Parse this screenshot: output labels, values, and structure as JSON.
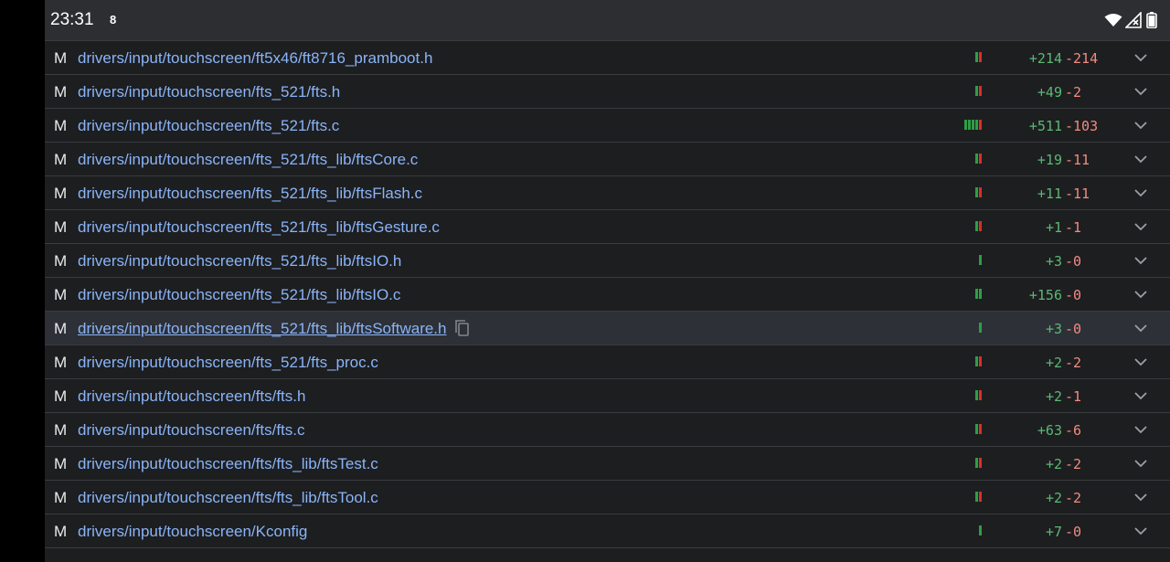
{
  "status_bar": {
    "time": "23:31",
    "notification_glyph": "8",
    "icons": [
      "wifi-icon",
      "signal-icon",
      "battery-icon"
    ]
  },
  "colors": {
    "path": "#8ab4f8",
    "added": "#5bb974",
    "deleted": "#f28b82",
    "bar_add": "#2e9e45",
    "bar_del": "#d93025"
  },
  "files": [
    {
      "status": "M",
      "path": "drivers/input/touchscreen/ft5x46/ft8716_pramboot.h",
      "added": "+214",
      "deleted": "-214",
      "bar": {
        "add": 1,
        "del": 1
      }
    },
    {
      "status": "M",
      "path": "drivers/input/touchscreen/fts_521/fts.h",
      "added": "+49",
      "deleted": "-2",
      "bar": {
        "add": 1,
        "del": 1
      }
    },
    {
      "status": "M",
      "path": "drivers/input/touchscreen/fts_521/fts.c",
      "added": "+511",
      "deleted": "-103",
      "bar": {
        "add": 4,
        "del": 1
      }
    },
    {
      "status": "M",
      "path": "drivers/input/touchscreen/fts_521/fts_lib/ftsCore.c",
      "added": "+19",
      "deleted": "-11",
      "bar": {
        "add": 1,
        "del": 1
      }
    },
    {
      "status": "M",
      "path": "drivers/input/touchscreen/fts_521/fts_lib/ftsFlash.c",
      "added": "+11",
      "deleted": "-11",
      "bar": {
        "add": 1,
        "del": 1
      }
    },
    {
      "status": "M",
      "path": "drivers/input/touchscreen/fts_521/fts_lib/ftsGesture.c",
      "added": "+1",
      "deleted": "-1",
      "bar": {
        "add": 1,
        "del": 1
      }
    },
    {
      "status": "M",
      "path": "drivers/input/touchscreen/fts_521/fts_lib/ftsIO.h",
      "added": "+3",
      "deleted": "-0",
      "bar": {
        "add": 1,
        "del": 0
      }
    },
    {
      "status": "M",
      "path": "drivers/input/touchscreen/fts_521/fts_lib/ftsIO.c",
      "added": "+156",
      "deleted": "-0",
      "bar": {
        "add": 2,
        "del": 0
      }
    },
    {
      "status": "M",
      "path": "drivers/input/touchscreen/fts_521/fts_lib/ftsSoftware.h",
      "added": "+3",
      "deleted": "-0",
      "bar": {
        "add": 1,
        "del": 0
      },
      "hovered": true
    },
    {
      "status": "M",
      "path": "drivers/input/touchscreen/fts_521/fts_proc.c",
      "added": "+2",
      "deleted": "-2",
      "bar": {
        "add": 1,
        "del": 1
      }
    },
    {
      "status": "M",
      "path": "drivers/input/touchscreen/fts/fts.h",
      "added": "+2",
      "deleted": "-1",
      "bar": {
        "add": 1,
        "del": 1
      }
    },
    {
      "status": "M",
      "path": "drivers/input/touchscreen/fts/fts.c",
      "added": "+63",
      "deleted": "-6",
      "bar": {
        "add": 1,
        "del": 1
      }
    },
    {
      "status": "M",
      "path": "drivers/input/touchscreen/fts/fts_lib/ftsTest.c",
      "added": "+2",
      "deleted": "-2",
      "bar": {
        "add": 1,
        "del": 1
      }
    },
    {
      "status": "M",
      "path": "drivers/input/touchscreen/fts/fts_lib/ftsTool.c",
      "added": "+2",
      "deleted": "-2",
      "bar": {
        "add": 1,
        "del": 1
      }
    },
    {
      "status": "M",
      "path": "drivers/input/touchscreen/Kconfig",
      "added": "+7",
      "deleted": "-0",
      "bar": {
        "add": 1,
        "del": 0
      }
    }
  ]
}
